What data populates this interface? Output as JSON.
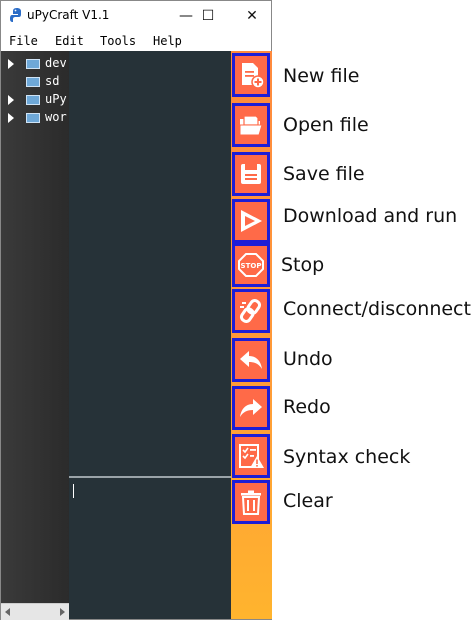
{
  "window": {
    "title": "uPyCraft V1.1"
  },
  "window_controls": {
    "minimize": "—",
    "maximize": "☐",
    "close": "✕"
  },
  "menu": [
    "File",
    "Edit",
    "Tools",
    "Help"
  ],
  "tree": [
    {
      "label": "dev",
      "expandable": true
    },
    {
      "label": "sd",
      "expandable": false
    },
    {
      "label": "uPy",
      "expandable": true
    },
    {
      "label": "wor",
      "expandable": true
    }
  ],
  "toolbar": [
    {
      "name": "new-file",
      "icon": "new-file-icon",
      "callout": "New file"
    },
    {
      "name": "open-file",
      "icon": "open-folder-icon",
      "callout": "Open file"
    },
    {
      "name": "save-file",
      "icon": "save-icon",
      "callout": "Save file"
    },
    {
      "name": "download-and-run",
      "icon": "play-icon",
      "callout": "Download and run"
    },
    {
      "name": "stop",
      "icon": "stop-sign-icon",
      "callout": "Stop"
    },
    {
      "name": "connect-disconnect",
      "icon": "link-icon",
      "callout": "Connect/disconnect"
    },
    {
      "name": "undo",
      "icon": "undo-arrow-icon",
      "callout": "Undo"
    },
    {
      "name": "redo",
      "icon": "redo-arrow-icon",
      "callout": "Redo"
    },
    {
      "name": "syntax-check",
      "icon": "checklist-warning-icon",
      "callout": "Syntax check"
    },
    {
      "name": "clear",
      "icon": "trash-icon",
      "callout": "Clear"
    }
  ],
  "stop_icon_text": "STOP",
  "colors": {
    "editor_bg": "#263238",
    "toolbar_orange": "#ff6a48",
    "highlight_border": "#1d1dd6"
  }
}
